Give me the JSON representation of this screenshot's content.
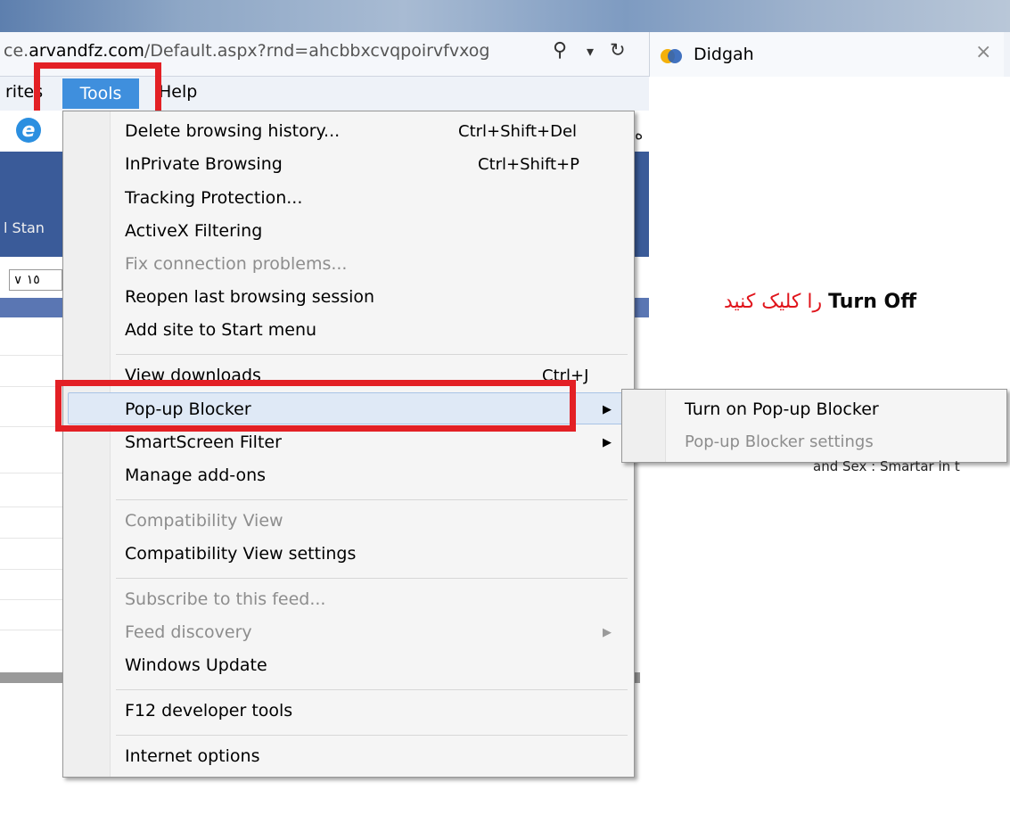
{
  "address": {
    "url_prefix": "ce.",
    "url_domain": "arvandfz.com",
    "url_rest": "/Default.aspx?rnd=ahcbbxcvqpoirvfvxog",
    "search_glyph": "⚲",
    "dropdown_glyph": "▾",
    "refresh_glyph": "↻"
  },
  "tab": {
    "title": "Didgah",
    "close_glyph": "×"
  },
  "menubar": {
    "favorites": "rites",
    "tools": "Tools",
    "help": "Help"
  },
  "background": {
    "side_label": "l Stan",
    "select_value": "∨ ١٥",
    "side_glyph": "ﻩ"
  },
  "tools_menu": {
    "items": [
      {
        "label": "Delete browsing history...",
        "shortcut": "Ctrl+Shift+Del"
      },
      {
        "label": "InPrivate Browsing",
        "shortcut": "Ctrl+Shift+P"
      },
      {
        "label": "Tracking Protection..."
      },
      {
        "label": "ActiveX Filtering"
      },
      {
        "label": "Fix connection problems...",
        "disabled": true
      },
      {
        "label": "Reopen last browsing session"
      },
      {
        "label": "Add site to Start menu"
      },
      {
        "label": "View downloads",
        "shortcut": "Ctrl+J"
      },
      {
        "label": "Pop-up Blocker"
      },
      {
        "label": "SmartScreen Filter"
      },
      {
        "label": "Manage add-ons"
      },
      {
        "label": "Compatibility View",
        "disabled": true
      },
      {
        "label": "Compatibility View settings"
      },
      {
        "label": "Subscribe to this feed...",
        "disabled": true
      },
      {
        "label": "Feed discovery",
        "disabled": true
      },
      {
        "label": "Windows Update"
      },
      {
        "label": "F12 developer tools"
      },
      {
        "label": "Internet options"
      }
    ],
    "submenu_arrow": "▶"
  },
  "popup_submenu": {
    "items": [
      {
        "label": "Turn on Pop-up Blocker"
      },
      {
        "label": "Pop-up Blocker settings",
        "disabled": true
      }
    ]
  },
  "instruction": {
    "bold": "Turn Off",
    "text": "را کلیک کنید"
  },
  "right_fragment": "and Sex : Smartar in t",
  "colors": {
    "highlight_red": "#e32025",
    "menu_select_blue": "#3f8fdd",
    "instruction_red": "#e0141b"
  }
}
